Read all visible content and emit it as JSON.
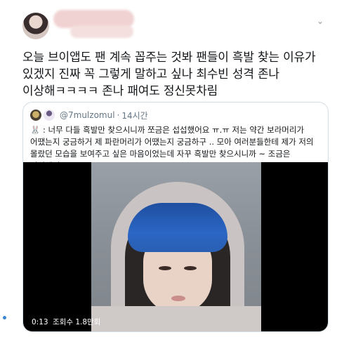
{
  "tweet": {
    "text": "오늘 브이앱도 팬 계속 꼽주는 것봐 팬들이 흑발 찾는 이유가 있겠지 진짜 꼭 그렇게 말하고 싶나 최수빈 성격 존나 이상해ㅋㅋㅋㅋ 존나 패여도 정신못차림"
  },
  "quoted_tweet": {
    "handle": "@7mulzomul",
    "separator": "·",
    "time": "14시간",
    "text": "🐰 : 너무 다들 흑발만 찾으시니까 쪼금은 섭섭했어요 ㅠ.ㅠ 저는 약간 보라머리가 어땠는지 궁금하거 제 파란머리가 어땠는지 궁금하구 .. 모아 여러분들한테 제가 저의 몰랐던 모습을 보여주고 싶은 마음이었는데 자꾸 흑발만 찾으시니까 ~ 조금은 섭섭해여"
  },
  "video": {
    "timestamp": "0:13",
    "views": "조회수 1.8만회"
  },
  "icons": {
    "more": "chevron-down-icon"
  }
}
